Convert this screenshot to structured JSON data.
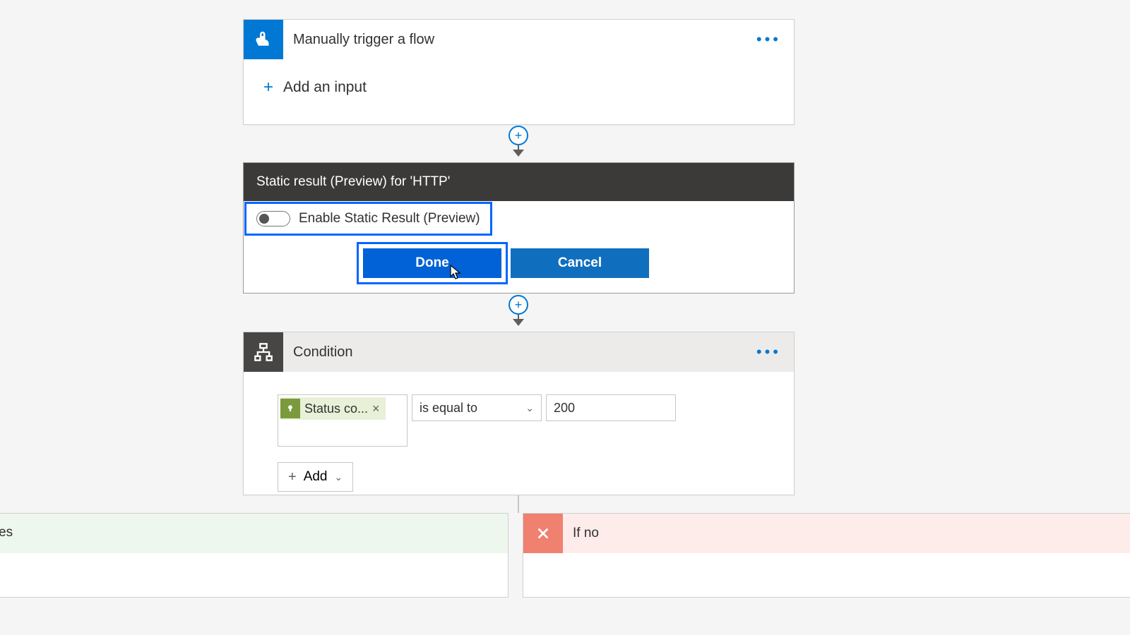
{
  "trigger": {
    "title": "Manually trigger a flow",
    "add_input_label": "Add an input"
  },
  "static_result": {
    "header": "Static result (Preview) for 'HTTP'",
    "toggle_label": "Enable Static Result (Preview)",
    "done_label": "Done",
    "cancel_label": "Cancel"
  },
  "condition": {
    "title": "Condition",
    "token_label": "Status co...",
    "operator": "is equal to",
    "value": "200",
    "add_label": "Add"
  },
  "branches": {
    "yes_fragment": "es",
    "no_label": "If no"
  }
}
